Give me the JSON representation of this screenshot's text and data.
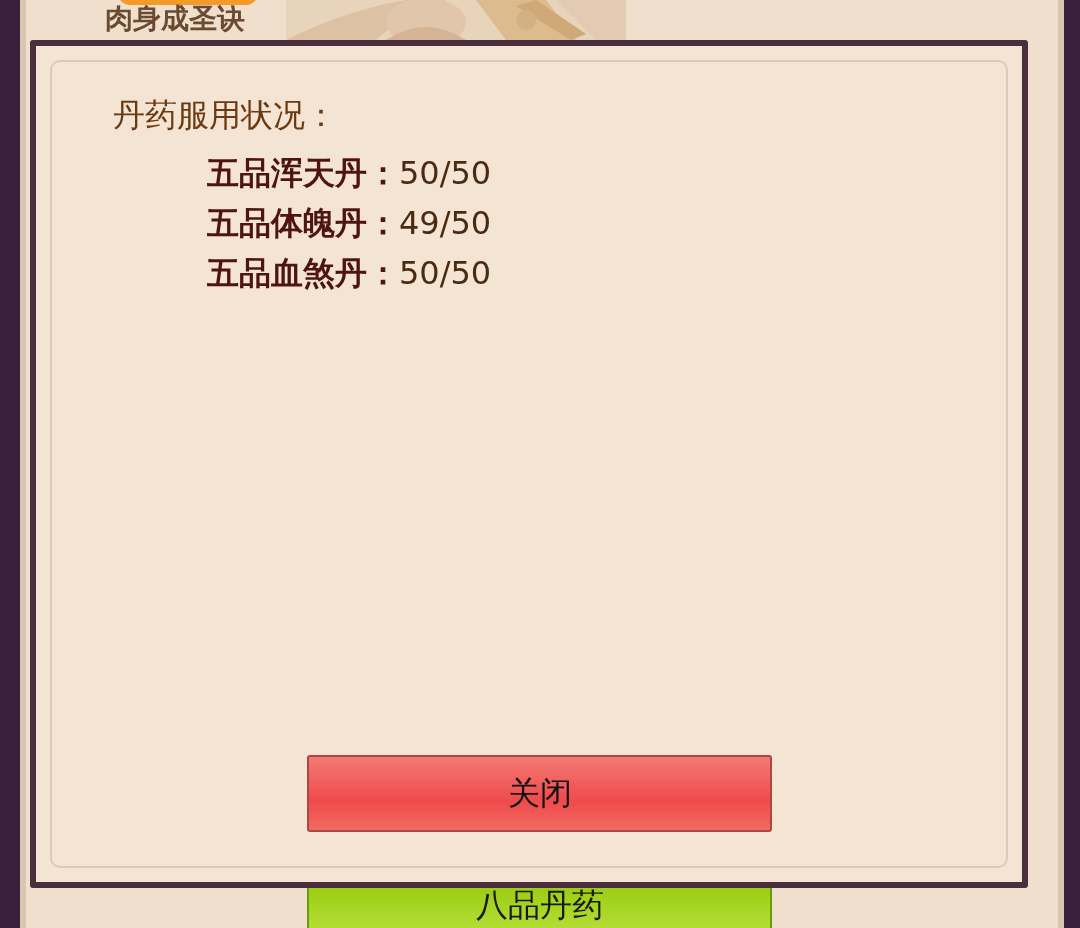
{
  "page": {
    "title": "肉身成圣诀",
    "pill_buttons": [
      {
        "label": "八品丹药",
        "kind": "green"
      }
    ]
  },
  "dialog": {
    "title": "丹药服用状况：",
    "entries": [
      {
        "name": "五品浑天丹：",
        "count": "50/50"
      },
      {
        "name": "五品体魄丹：",
        "count": "49/50"
      },
      {
        "name": "五品血煞丹：",
        "count": "50/50"
      }
    ],
    "close_button": "关闭"
  }
}
